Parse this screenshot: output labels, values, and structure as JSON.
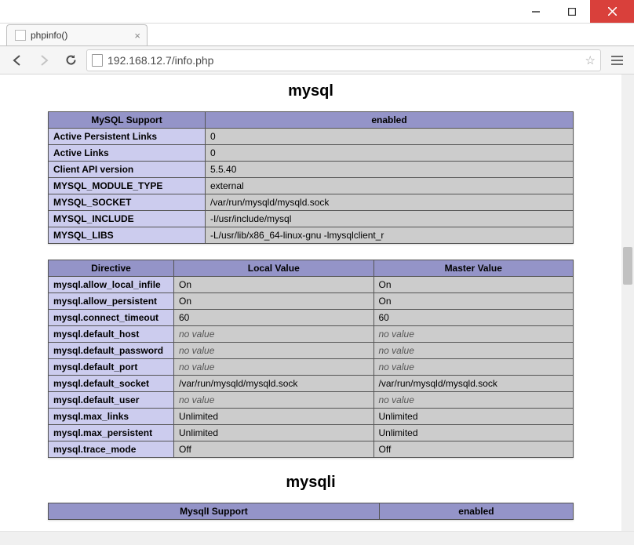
{
  "window": {
    "tab_title": "phpinfo()",
    "url": "192.168.12.7/info.php"
  },
  "sections": {
    "mysql": {
      "heading": "mysql",
      "support_header_left": "MySQL Support",
      "support_header_right": "enabled",
      "info_rows": [
        {
          "k": "Active Persistent Links",
          "v": "0"
        },
        {
          "k": "Active Links",
          "v": "0"
        },
        {
          "k": "Client API version",
          "v": "5.5.40"
        },
        {
          "k": "MYSQL_MODULE_TYPE",
          "v": "external"
        },
        {
          "k": "MYSQL_SOCKET",
          "v": "/var/run/mysqld/mysqld.sock"
        },
        {
          "k": "MYSQL_INCLUDE",
          "v": "-I/usr/include/mysql"
        },
        {
          "k": "MYSQL_LIBS",
          "v": "-L/usr/lib/x86_64-linux-gnu -lmysqlclient_r"
        }
      ],
      "dir_headers": {
        "c0": "Directive",
        "c1": "Local Value",
        "c2": "Master Value"
      },
      "dir_rows": [
        {
          "k": "mysql.allow_local_infile",
          "l": "On",
          "m": "On"
        },
        {
          "k": "mysql.allow_persistent",
          "l": "On",
          "m": "On"
        },
        {
          "k": "mysql.connect_timeout",
          "l": "60",
          "m": "60"
        },
        {
          "k": "mysql.default_host",
          "l": "no value",
          "m": "no value",
          "novalue": true
        },
        {
          "k": "mysql.default_password",
          "l": "no value",
          "m": "no value",
          "novalue": true
        },
        {
          "k": "mysql.default_port",
          "l": "no value",
          "m": "no value",
          "novalue": true
        },
        {
          "k": "mysql.default_socket",
          "l": "/var/run/mysqld/mysqld.sock",
          "m": "/var/run/mysqld/mysqld.sock"
        },
        {
          "k": "mysql.default_user",
          "l": "no value",
          "m": "no value",
          "novalue": true
        },
        {
          "k": "mysql.max_links",
          "l": "Unlimited",
          "m": "Unlimited"
        },
        {
          "k": "mysql.max_persistent",
          "l": "Unlimited",
          "m": "Unlimited"
        },
        {
          "k": "mysql.trace_mode",
          "l": "Off",
          "m": "Off"
        }
      ]
    },
    "mysqli": {
      "heading": "mysqli",
      "support_header_left": "MysqlI Support",
      "support_header_right": "enabled"
    }
  }
}
